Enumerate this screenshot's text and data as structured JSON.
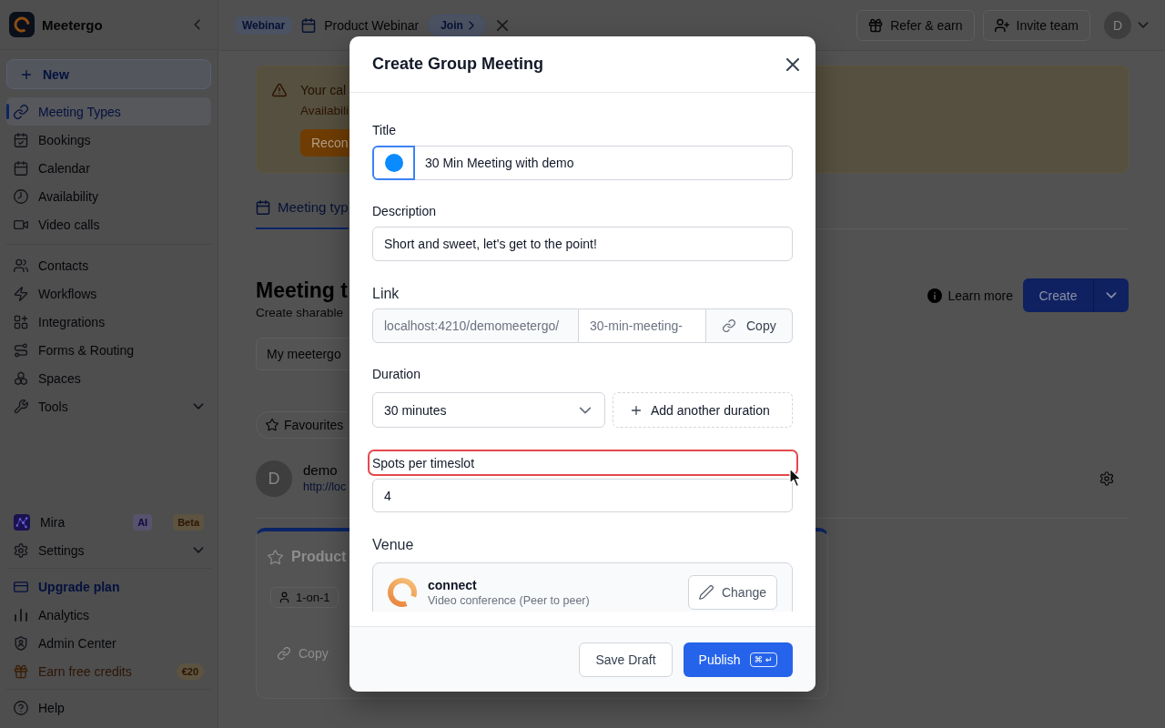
{
  "sidebar": {
    "brand": "Meetergo",
    "new_button": "New",
    "sections": [
      {
        "items": [
          {
            "label": "Meeting Types",
            "kind": "nav",
            "selected": true
          },
          {
            "label": "Bookings",
            "kind": "nav",
            "selected": false
          },
          {
            "label": "Calendar",
            "kind": "nav",
            "selected": false
          },
          {
            "label": "Availability",
            "kind": "nav",
            "selected": false
          },
          {
            "label": "Video calls",
            "kind": "nav",
            "selected": false
          }
        ]
      },
      {
        "items": [
          {
            "label": "Contacts",
            "kind": "nav",
            "selected": false
          },
          {
            "label": "Workflows",
            "kind": "nav",
            "selected": false
          },
          {
            "label": "Integrations",
            "kind": "nav",
            "selected": false
          },
          {
            "label": "Forms & Routing",
            "kind": "nav",
            "selected": false
          },
          {
            "label": "Spaces",
            "kind": "nav",
            "selected": false
          },
          {
            "label": "Tools",
            "kind": "group",
            "selected": false,
            "expanded": false
          }
        ]
      }
    ],
    "footer_sections": [
      {
        "items": [
          {
            "label": "Mira",
            "kind": "nav",
            "selected": false,
            "badges": [
              {
                "label": "AI",
                "kind": "ai"
              },
              {
                "label": "Beta",
                "kind": "beta"
              }
            ]
          },
          {
            "label": "Settings",
            "kind": "group",
            "selected": false,
            "expanded": false
          }
        ]
      },
      {
        "items": [
          {
            "label": "Upgrade plan",
            "kind": "upgrade",
            "selected": false
          },
          {
            "label": "Analytics",
            "kind": "nav",
            "selected": false
          },
          {
            "label": "Admin Center",
            "kind": "nav",
            "selected": false
          },
          {
            "label": "Earn free credits",
            "kind": "promo",
            "selected": false,
            "badges": [
              {
                "label": "€20",
                "kind": "credit"
              }
            ]
          }
        ]
      },
      {
        "items": [
          {
            "label": "Help",
            "kind": "nav",
            "selected": false
          }
        ]
      }
    ]
  },
  "top_bar": {
    "event": {
      "badge": "Webinar",
      "title": "Product Webinar",
      "join_button": "Join"
    },
    "actions": [
      "Refer & earn",
      "Invite team"
    ],
    "avatar": "D"
  },
  "alert": {
    "title": "Your cal",
    "text": "Availabili",
    "button": "Recon"
  },
  "tabs": [
    {
      "label": "Meeting typ",
      "selected": true
    }
  ],
  "header": {
    "title": "Meeting t",
    "subtitle": "Create sharable",
    "learn_more": "Learn more",
    "create_button": "Create"
  },
  "filters": {
    "workspace": "My meetergo",
    "favourites": "Favourites"
  },
  "owner": {
    "avatar": "D",
    "name": "demo",
    "url": "http://loc"
  },
  "cards": [
    {
      "title": "Product",
      "tags": [
        "1-on-1"
      ],
      "copy_button": "Copy"
    }
  ],
  "modal": {
    "title": "Create Group Meeting",
    "fields": [
      {
        "kind": "title",
        "label": "Title",
        "color": "#0a8bff",
        "value": "30 Min Meeting with demo",
        "highlighted": false
      },
      {
        "kind": "text",
        "label": "Description",
        "value": "Short and sweet, let's get to the point!",
        "highlighted": false
      },
      {
        "kind": "link",
        "label": "Link",
        "prefix": "localhost:4210/demomeetergo/",
        "value": "30-min-meeting-",
        "button": "Copy",
        "highlighted": false
      },
      {
        "kind": "duration",
        "label": "Duration",
        "value": "30 minutes",
        "button": "Add another duration",
        "highlighted": false
      },
      {
        "kind": "text",
        "label": "Spots per timeslot",
        "value": "4",
        "highlighted": true
      },
      {
        "kind": "venue",
        "label": "Venue",
        "name": "connect",
        "description": "Video conference (Peer to peer)",
        "button": "Change",
        "highlighted": false
      }
    ],
    "buttons": {
      "save": "Save Draft",
      "publish": "Publish",
      "shortcut": "⌘ ↵"
    }
  }
}
